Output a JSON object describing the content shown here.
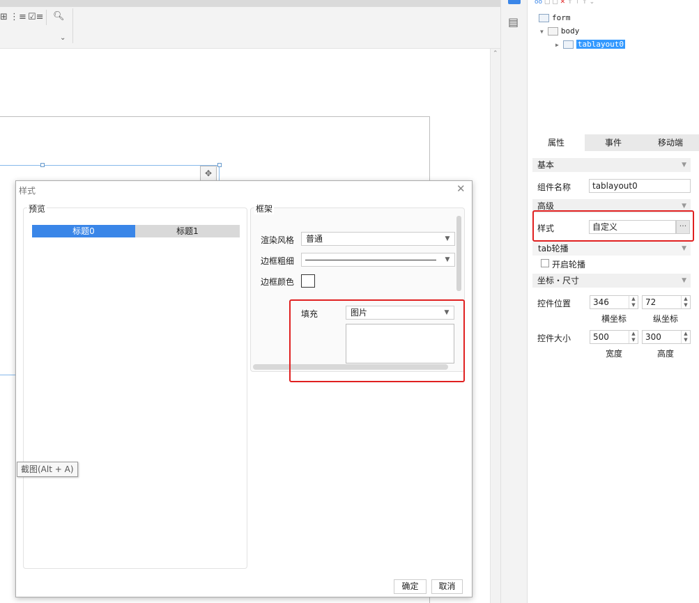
{
  "tree": {
    "items": [
      {
        "label": "form",
        "level": 0
      },
      {
        "label": "body",
        "level": 1
      },
      {
        "label": "tablayout0",
        "level": 2,
        "selected": true
      }
    ]
  },
  "right_tabs": [
    "属性",
    "事件",
    "移动端"
  ],
  "props": {
    "basic_section": "基本",
    "component_name_label": "组件名称",
    "component_name_value": "tablayout0",
    "advanced_section": "高级",
    "style_label": "样式",
    "style_value": "自定义",
    "style_button": "···",
    "tab_carousel_section": "tab轮播",
    "carousel_checkbox_label": "开启轮播",
    "coords_section": "坐标・尺寸",
    "position_label": "控件位置",
    "pos_x": "346",
    "pos_y": "72",
    "x_caption": "横坐标",
    "y_caption": "纵坐标",
    "size_label": "控件大小",
    "width": "500",
    "height": "300",
    "width_caption": "宽度",
    "height_caption": "高度"
  },
  "dialog": {
    "title": "样式",
    "preview_label": "预览",
    "preview_tabs": [
      "标题0",
      "标题1"
    ],
    "frame_label": "框架",
    "render_style_label": "渲染风格",
    "render_style_value": "普通",
    "border_width_label": "边框粗细",
    "border_color_label": "边框颜色",
    "fill_label": "填充",
    "fill_value": "图片",
    "ok_button": "确定",
    "cancel_button": "取消"
  },
  "tooltip": "截图(Alt + A)",
  "colors": {
    "accent": "#3a86e8",
    "highlight": "#e02020",
    "selection": "#3399ff"
  }
}
